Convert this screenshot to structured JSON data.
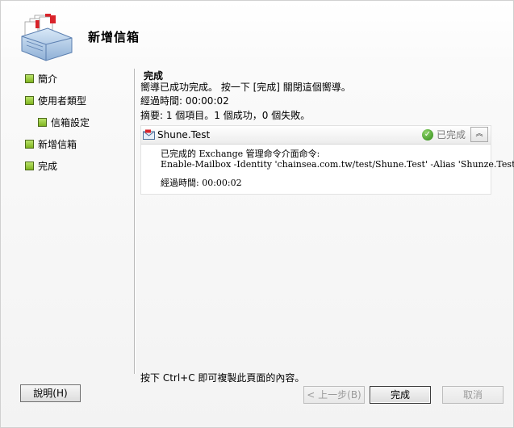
{
  "header": {
    "title": "新增信箱",
    "icon": "mailbox-stack-icon"
  },
  "nav": {
    "items": [
      {
        "label": "簡介"
      },
      {
        "label": "使用者類型"
      },
      {
        "label": "信箱設定"
      },
      {
        "label": "新增信箱"
      },
      {
        "label": "完成"
      }
    ]
  },
  "content": {
    "section_title": "完成",
    "message": "嚮導已成功完成。 按一下 [完成] 關閉這個嚮導。",
    "elapsed": "經過時間: 00:00:02",
    "summary": "摘要: 1 個項目。1 個成功，0 個失敗。",
    "task": {
      "name": "Shune.Test",
      "status": "已完成",
      "command_label": "已完成的 Exchange 管理命令介面命令:",
      "command": "Enable-Mailbox -Identity 'chainsea.com.tw/test/Shune.Test' -Alias 'Shunze.Test'",
      "elapsed": "經過時間: 00:00:02"
    },
    "copy_hint": "按下 Ctrl+C 即可複製此頁面的內容。"
  },
  "buttons": {
    "help": "說明(H)",
    "back": "< 上一步(B)",
    "finish": "完成",
    "cancel": "取消"
  },
  "colors": {
    "nav_bullet": "#8cc12c",
    "status_check": "#3a9a1f"
  }
}
